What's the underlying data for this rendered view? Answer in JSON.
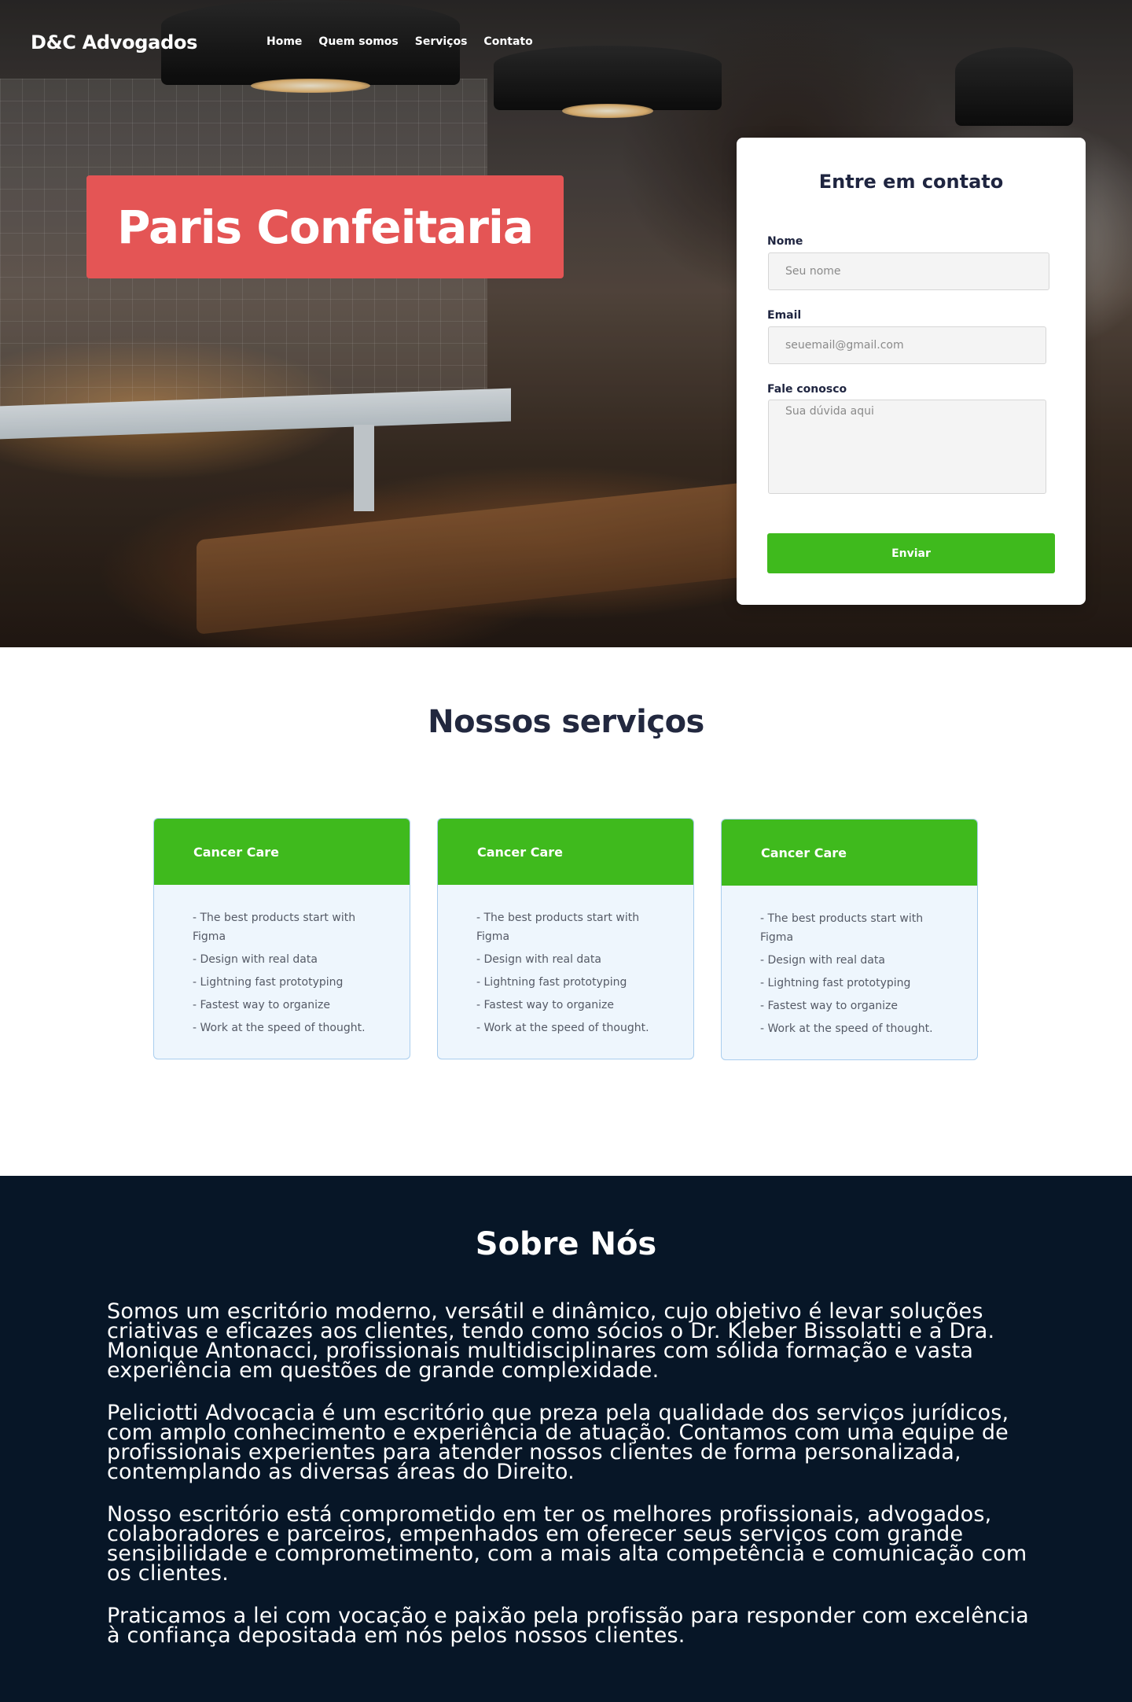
{
  "nav": {
    "brand": "D&C Advogados",
    "links": [
      "Home",
      "Quem somos",
      "Serviços",
      "Contato"
    ]
  },
  "hero": {
    "title": "Paris Confeitaria",
    "background_image": "bakery-counter-photo"
  },
  "contact": {
    "title": "Entre em contato",
    "name_label": "Nome",
    "name_placeholder": "Seu nome",
    "email_label": "Email",
    "email_placeholder": "seuemail@gmail.com",
    "message_label": "Fale conosco",
    "message_placeholder": "Sua dúvida aqui",
    "submit_label": "Enviar"
  },
  "services": {
    "title": "Nossos serviços",
    "cards": [
      {
        "title": "Cancer Care",
        "items": [
          "-  The best products start with Figma",
          "- Design with real data",
          "- Lightning fast prototyping",
          "- Fastest way to organize",
          "- Work at the speed of thought."
        ]
      },
      {
        "title": "Cancer Care",
        "items": [
          "-  The best products start with Figma",
          "- Design with real data",
          "- Lightning fast prototyping",
          "- Fastest way to organize",
          "- Work at the speed of thought."
        ]
      },
      {
        "title": "Cancer Care",
        "items": [
          "-  The best products start with Figma",
          "- Design with real data",
          "- Lightning fast prototyping",
          "- Fastest way to organize",
          "- Work at the speed of thought."
        ]
      }
    ]
  },
  "about": {
    "title": "Sobre Nós",
    "paragraphs": [
      "Somos um  escritório moderno, versátil e dinâmico, cujo objetivo é levar soluções criativas e eficazes aos clientes, tendo como sócios o Dr. Kleber Bissolatti e a Dra. Monique Antonacci, profissionais multidisciplinares com sólida formação e vasta experiência em questões de grande complexidade.",
      "Peliciotti Advocacia é um escritório que preza pela qualidade dos serviços jurídicos, com amplo conhecimento e experiência de atuação. Contamos com uma equipe de profissionais experientes para atender nossos clientes de forma personalizada, contemplando as diversas áreas do Direito.",
      "Nosso escritório está comprometido em ter os melhores profissionais, advogados, colaboradores e parceiros, empenhados em oferecer seus serviços com grande sensibilidade e comprometimento, com a mais alta competência e comunicação com os clientes.",
      "Praticamos a lei com vocação e paixão pela profissão para responder com excelência à confiança depositada em nós pelos nossos clientes."
    ]
  },
  "colors": {
    "accent_green": "#3fba1d",
    "hero_title_bg": "#e45555",
    "about_bg": "#071627",
    "heading_text": "#22283f"
  }
}
